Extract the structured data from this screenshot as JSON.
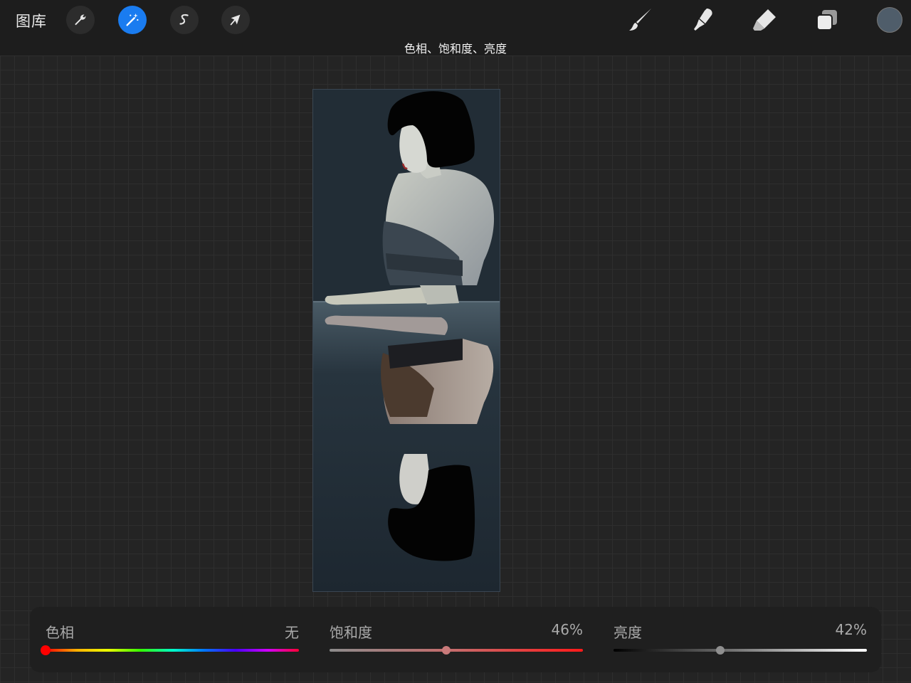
{
  "topbar": {
    "gallery_label": "图库",
    "tools_left": [
      {
        "name": "actions",
        "icon": "wrench-icon",
        "active": false
      },
      {
        "name": "adjustments",
        "icon": "magic-wand-icon",
        "active": true
      },
      {
        "name": "selection",
        "icon": "selection-s-icon",
        "active": false
      },
      {
        "name": "transform",
        "icon": "arrow-cursor-icon",
        "active": false
      }
    ],
    "tools_right": [
      {
        "name": "brush",
        "icon": "brush-icon"
      },
      {
        "name": "smudge",
        "icon": "smudge-icon"
      },
      {
        "name": "eraser",
        "icon": "eraser-icon"
      },
      {
        "name": "layers",
        "icon": "layers-icon"
      }
    ],
    "current_color": "#4f5d6a"
  },
  "mode_title": "色相、饱和度、亮度",
  "adjustments": {
    "hue": {
      "label": "色相",
      "value": "无",
      "level": 0.0
    },
    "saturation": {
      "label": "饱和度",
      "value": "46%",
      "level": 0.46
    },
    "brightness": {
      "label": "亮度",
      "value": "42%",
      "level": 0.42
    }
  },
  "colors": {
    "accent": "#1a7cf0",
    "topbar": "#1d1d1d",
    "panel": "#1f1f1f",
    "canvas_bg": "#242424",
    "artwork_bg": "#202a33"
  }
}
